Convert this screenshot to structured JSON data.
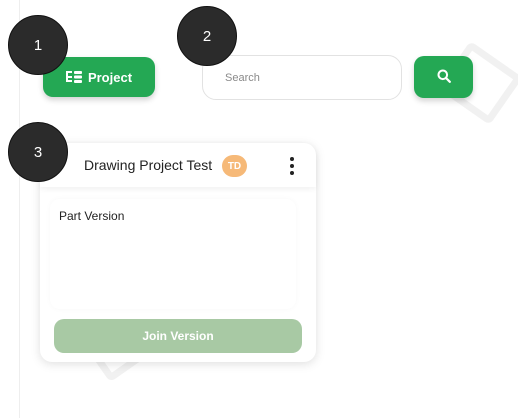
{
  "markers": [
    "1",
    "2",
    "3"
  ],
  "toolbar": {
    "project_label": "Project",
    "project_icon": "project-tree-icon",
    "search_placeholder": "Search",
    "search_icon": "search-icon",
    "accent": "#24a854"
  },
  "card": {
    "title": "Drawing Project Test",
    "avatar_initials": "TD",
    "avatar_color": "#f6b978",
    "menu_icon": "kebab-menu-icon",
    "section_label": "Part Version",
    "join_label": "Join Version",
    "join_color": "#a8c9a4"
  }
}
